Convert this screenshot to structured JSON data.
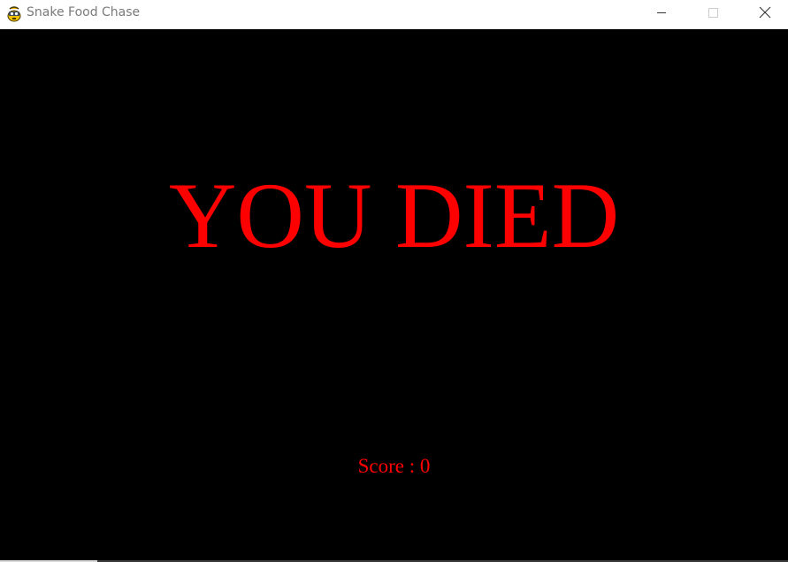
{
  "window": {
    "title": "Snake Food Chase",
    "icon": "pygame-snake-icon"
  },
  "controls": {
    "minimize_icon": "minimize-icon",
    "maximize_icon": "maximize-icon",
    "close_icon": "close-icon"
  },
  "game": {
    "background_color": "#000000",
    "text_color": "#ff0000",
    "headline": "YOU DIED",
    "score_text": "Score : 0"
  }
}
